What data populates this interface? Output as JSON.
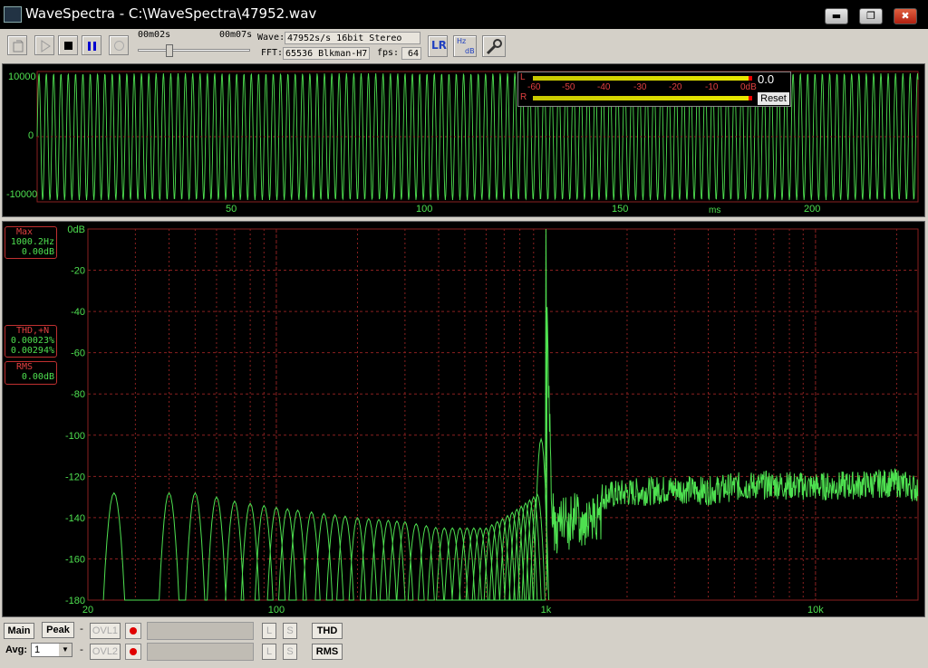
{
  "window": {
    "title": "WaveSpectra - C:\\WaveSpectra\\47952.wav",
    "minimize_glyph": "▬",
    "restore_glyph": "❐",
    "close_glyph": "✖"
  },
  "toolbar": {
    "pos_start": "00m02s",
    "pos_end": "00m07s",
    "wave_label": "Wave:",
    "wave_value": "47952s/s 16bit Stereo",
    "fft_label": "FFT:",
    "fft_value": "65536 Blkman-H7",
    "fps_label": "fps:",
    "fps_value": "64",
    "slider_position": 0.27,
    "lr_label": "LR",
    "hz_label": "Hz",
    "db_label": "dB"
  },
  "meter": {
    "peak_value": "0.0",
    "scale": [
      "-60",
      "-50",
      "-40",
      "-30",
      "-20",
      "-10",
      "0dB"
    ],
    "left_label": "L",
    "right_label": "R",
    "reset_label": "Reset",
    "left_level": 1.0,
    "right_level": 1.0
  },
  "wave_panel": {
    "y_labels": [
      "10000",
      "0",
      "-10000"
    ],
    "x_labels": [
      "50",
      "100",
      "150",
      "200"
    ],
    "x_unit": "ms"
  },
  "spectrum_panel": {
    "y_labels": [
      "0dB",
      "-20",
      "-40",
      "-60",
      "-80",
      "-100",
      "-120",
      "-140",
      "-160",
      "-180"
    ],
    "x_labels": [
      "20",
      "100",
      "1k",
      "10k"
    ],
    "max_box": {
      "title": "Max",
      "freq": "1000.2Hz",
      "level": "0.00dB"
    },
    "thd_box": {
      "title": "THD,+N",
      "thd": "0.00023%",
      "thdn": "0.00294%"
    },
    "rms_box": {
      "title": "RMS",
      "level": "0.00dB"
    }
  },
  "chart_data": {
    "type": "line",
    "title": "",
    "xlabel": "",
    "ylabel": "",
    "xscale": "log",
    "xlim": [
      20,
      24000
    ],
    "ylim": [
      -180,
      0
    ],
    "grid": true,
    "series": [
      {
        "color": "#4ee050",
        "x": [
          20,
          25,
          30,
          40,
          50,
          60,
          70,
          100,
          150,
          200,
          300,
          400,
          500,
          600,
          700,
          800,
          900,
          950,
          1000,
          1050,
          1100,
          1200,
          1500,
          2000,
          3000,
          4000,
          5000,
          7000,
          10000,
          15000,
          20000,
          24000
        ],
        "y": [
          -180,
          -128,
          -180,
          -128,
          -128,
          -130,
          -132,
          -135,
          -138,
          -140,
          -142,
          -145,
          -145,
          -145,
          -140,
          -135,
          -130,
          -128,
          0,
          -130,
          -133,
          -130,
          -130,
          -128,
          -126,
          -127,
          -125,
          -124,
          -125,
          -124,
          -123,
          -126
        ]
      }
    ]
  },
  "bottom": {
    "main_label": "Main",
    "peak_label": "Peak",
    "avg_label": "Avg:",
    "avg_value": "1",
    "ovl1_label": "OVL1",
    "ovl2_label": "OVL2",
    "l_label": "L",
    "s_label": "S",
    "dash": "-",
    "thd_label": "THD",
    "rms_label": "RMS"
  },
  "colors": {
    "trace": "#4ee050",
    "grid": "#8a2020",
    "frame_bg": "#d4d0c8",
    "accent_red": "#e04040"
  }
}
